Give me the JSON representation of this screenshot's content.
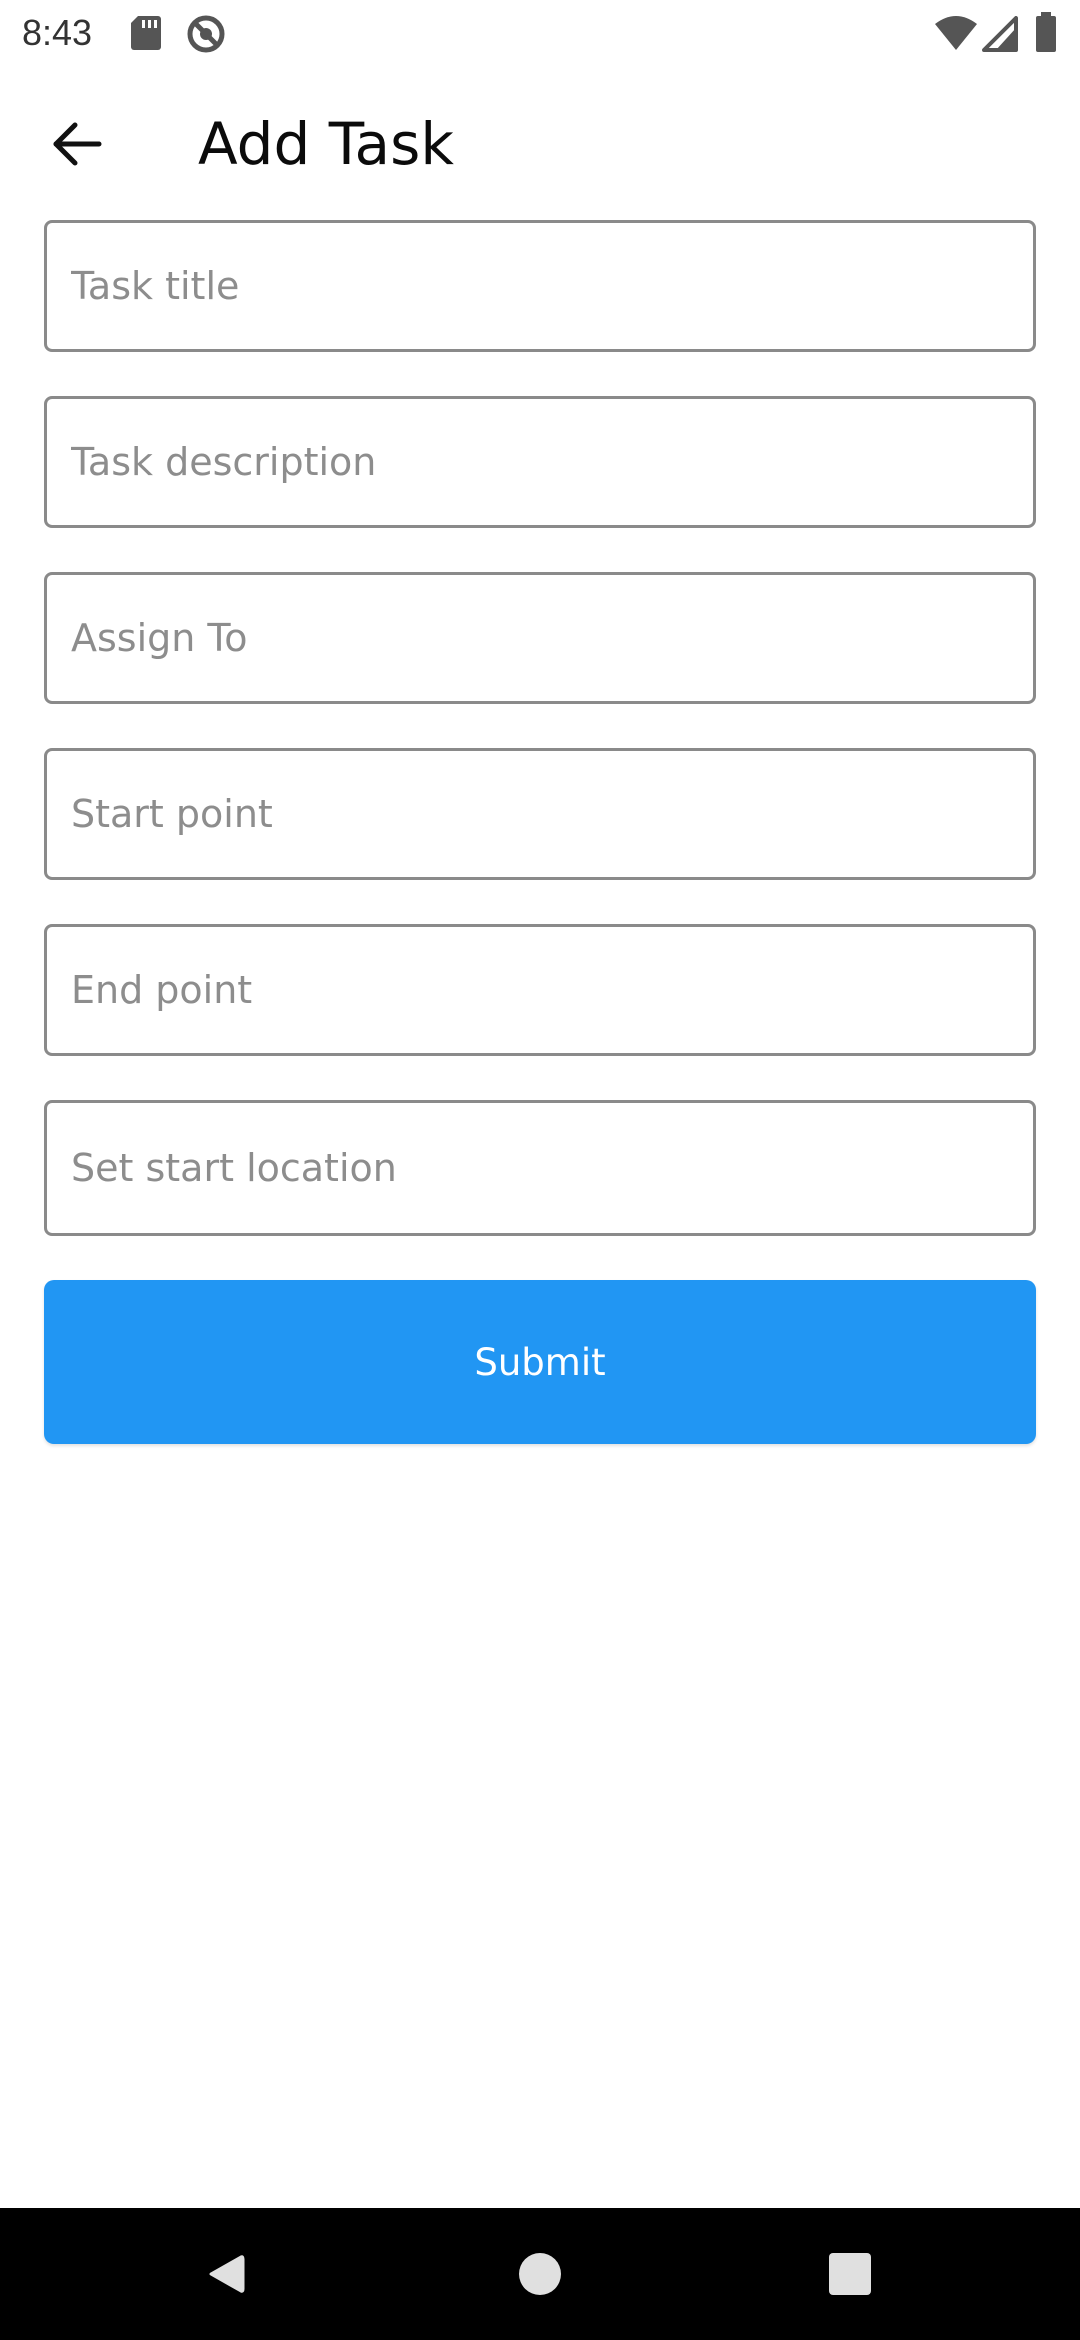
{
  "status_bar": {
    "time": "8:43",
    "icons": [
      "sd-card-icon",
      "do-not-disturb-icon",
      "wifi-icon",
      "signal-icon",
      "battery-icon"
    ]
  },
  "app_bar": {
    "title": "Add Task",
    "back_icon": "arrow-back-icon"
  },
  "form": {
    "fields": [
      {
        "placeholder": "Task title",
        "value": ""
      },
      {
        "placeholder": "Task description",
        "value": ""
      },
      {
        "placeholder": "Assign To",
        "value": ""
      },
      {
        "placeholder": "Start point",
        "value": ""
      },
      {
        "placeholder": "End point",
        "value": ""
      },
      {
        "placeholder": "Set start location",
        "value": ""
      }
    ],
    "submit_label": "Submit"
  },
  "nav_bar": {
    "icons": [
      "nav-back-icon",
      "nav-home-icon",
      "nav-recents-icon"
    ]
  },
  "colors": {
    "accent": "#2196f3",
    "field_border": "#8a8a8a",
    "placeholder": "#8d8d8d",
    "nav_background": "#000000"
  }
}
